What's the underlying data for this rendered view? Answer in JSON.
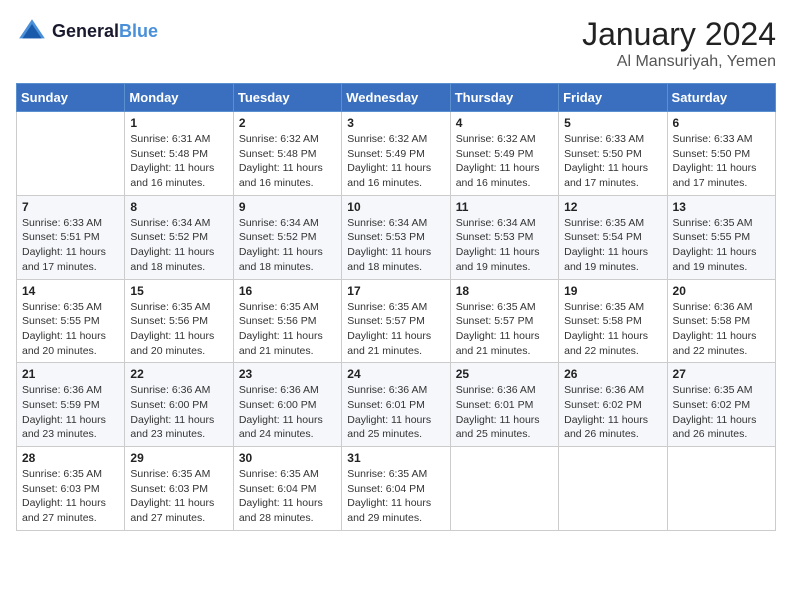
{
  "header": {
    "logo_line1": "General",
    "logo_line2": "Blue",
    "month": "January 2024",
    "location": "Al Mansuriyah, Yemen"
  },
  "columns": [
    "Sunday",
    "Monday",
    "Tuesday",
    "Wednesday",
    "Thursday",
    "Friday",
    "Saturday"
  ],
  "weeks": [
    [
      {
        "day": "",
        "info": ""
      },
      {
        "day": "1",
        "info": "Sunrise: 6:31 AM\nSunset: 5:48 PM\nDaylight: 11 hours\nand 16 minutes."
      },
      {
        "day": "2",
        "info": "Sunrise: 6:32 AM\nSunset: 5:48 PM\nDaylight: 11 hours\nand 16 minutes."
      },
      {
        "day": "3",
        "info": "Sunrise: 6:32 AM\nSunset: 5:49 PM\nDaylight: 11 hours\nand 16 minutes."
      },
      {
        "day": "4",
        "info": "Sunrise: 6:32 AM\nSunset: 5:49 PM\nDaylight: 11 hours\nand 16 minutes."
      },
      {
        "day": "5",
        "info": "Sunrise: 6:33 AM\nSunset: 5:50 PM\nDaylight: 11 hours\nand 17 minutes."
      },
      {
        "day": "6",
        "info": "Sunrise: 6:33 AM\nSunset: 5:50 PM\nDaylight: 11 hours\nand 17 minutes."
      }
    ],
    [
      {
        "day": "7",
        "info": "Sunrise: 6:33 AM\nSunset: 5:51 PM\nDaylight: 11 hours\nand 17 minutes."
      },
      {
        "day": "8",
        "info": "Sunrise: 6:34 AM\nSunset: 5:52 PM\nDaylight: 11 hours\nand 18 minutes."
      },
      {
        "day": "9",
        "info": "Sunrise: 6:34 AM\nSunset: 5:52 PM\nDaylight: 11 hours\nand 18 minutes."
      },
      {
        "day": "10",
        "info": "Sunrise: 6:34 AM\nSunset: 5:53 PM\nDaylight: 11 hours\nand 18 minutes."
      },
      {
        "day": "11",
        "info": "Sunrise: 6:34 AM\nSunset: 5:53 PM\nDaylight: 11 hours\nand 19 minutes."
      },
      {
        "day": "12",
        "info": "Sunrise: 6:35 AM\nSunset: 5:54 PM\nDaylight: 11 hours\nand 19 minutes."
      },
      {
        "day": "13",
        "info": "Sunrise: 6:35 AM\nSunset: 5:55 PM\nDaylight: 11 hours\nand 19 minutes."
      }
    ],
    [
      {
        "day": "14",
        "info": "Sunrise: 6:35 AM\nSunset: 5:55 PM\nDaylight: 11 hours\nand 20 minutes."
      },
      {
        "day": "15",
        "info": "Sunrise: 6:35 AM\nSunset: 5:56 PM\nDaylight: 11 hours\nand 20 minutes."
      },
      {
        "day": "16",
        "info": "Sunrise: 6:35 AM\nSunset: 5:56 PM\nDaylight: 11 hours\nand 21 minutes."
      },
      {
        "day": "17",
        "info": "Sunrise: 6:35 AM\nSunset: 5:57 PM\nDaylight: 11 hours\nand 21 minutes."
      },
      {
        "day": "18",
        "info": "Sunrise: 6:35 AM\nSunset: 5:57 PM\nDaylight: 11 hours\nand 21 minutes."
      },
      {
        "day": "19",
        "info": "Sunrise: 6:35 AM\nSunset: 5:58 PM\nDaylight: 11 hours\nand 22 minutes."
      },
      {
        "day": "20",
        "info": "Sunrise: 6:36 AM\nSunset: 5:58 PM\nDaylight: 11 hours\nand 22 minutes."
      }
    ],
    [
      {
        "day": "21",
        "info": "Sunrise: 6:36 AM\nSunset: 5:59 PM\nDaylight: 11 hours\nand 23 minutes."
      },
      {
        "day": "22",
        "info": "Sunrise: 6:36 AM\nSunset: 6:00 PM\nDaylight: 11 hours\nand 23 minutes."
      },
      {
        "day": "23",
        "info": "Sunrise: 6:36 AM\nSunset: 6:00 PM\nDaylight: 11 hours\nand 24 minutes."
      },
      {
        "day": "24",
        "info": "Sunrise: 6:36 AM\nSunset: 6:01 PM\nDaylight: 11 hours\nand 25 minutes."
      },
      {
        "day": "25",
        "info": "Sunrise: 6:36 AM\nSunset: 6:01 PM\nDaylight: 11 hours\nand 25 minutes."
      },
      {
        "day": "26",
        "info": "Sunrise: 6:36 AM\nSunset: 6:02 PM\nDaylight: 11 hours\nand 26 minutes."
      },
      {
        "day": "27",
        "info": "Sunrise: 6:35 AM\nSunset: 6:02 PM\nDaylight: 11 hours\nand 26 minutes."
      }
    ],
    [
      {
        "day": "28",
        "info": "Sunrise: 6:35 AM\nSunset: 6:03 PM\nDaylight: 11 hours\nand 27 minutes."
      },
      {
        "day": "29",
        "info": "Sunrise: 6:35 AM\nSunset: 6:03 PM\nDaylight: 11 hours\nand 27 minutes."
      },
      {
        "day": "30",
        "info": "Sunrise: 6:35 AM\nSunset: 6:04 PM\nDaylight: 11 hours\nand 28 minutes."
      },
      {
        "day": "31",
        "info": "Sunrise: 6:35 AM\nSunset: 6:04 PM\nDaylight: 11 hours\nand 29 minutes."
      },
      {
        "day": "",
        "info": ""
      },
      {
        "day": "",
        "info": ""
      },
      {
        "day": "",
        "info": ""
      }
    ]
  ]
}
